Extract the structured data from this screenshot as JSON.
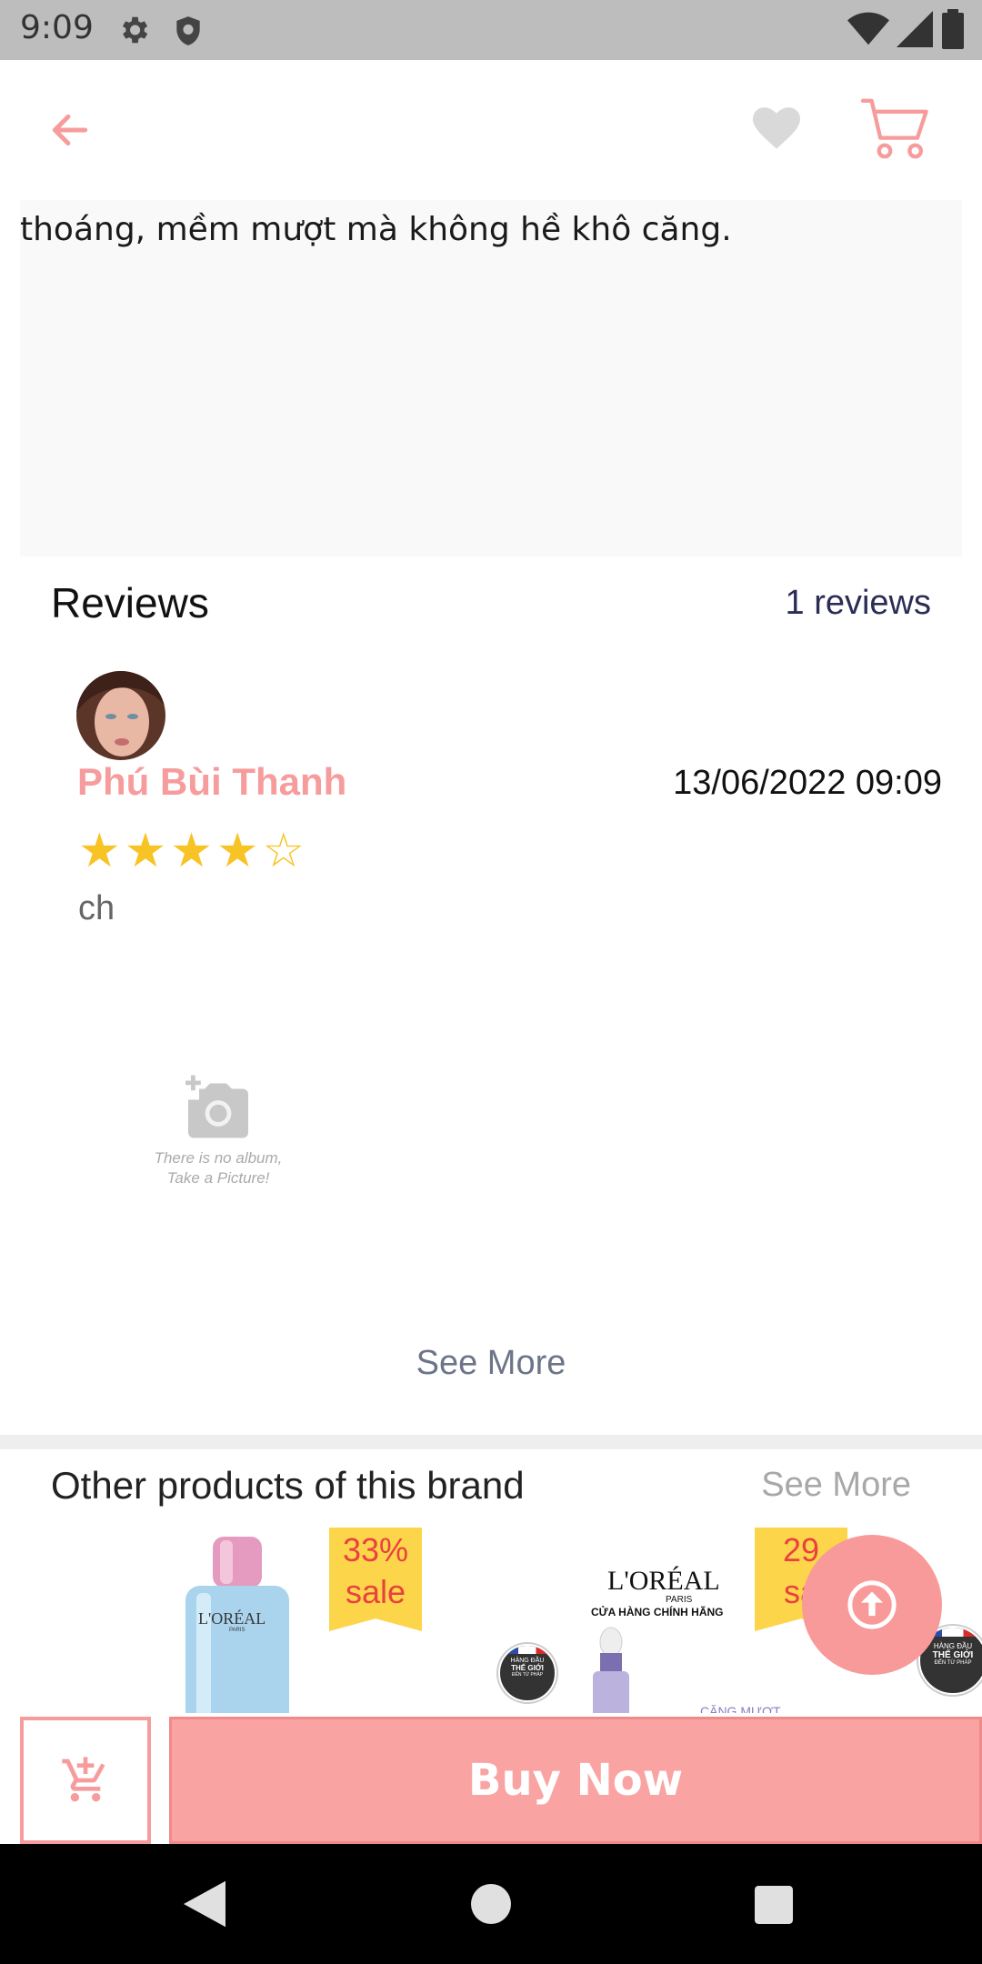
{
  "status_bar": {
    "time": "9:09"
  },
  "description": {
    "text": "thoáng, mềm mượt mà không hề khô căng."
  },
  "reviews": {
    "title": "Reviews",
    "count_label": "1 reviews",
    "items": [
      {
        "name": "Phú Bùi Thanh",
        "date": "13/06/2022 09:09",
        "rating": 4,
        "max_rating": 5,
        "text": "ch"
      }
    ],
    "no_album_line1": "There is no album,",
    "no_album_line2": "Take a Picture!",
    "see_more": "See More"
  },
  "other_products": {
    "title": "Other products of this brand",
    "see_more": "See More",
    "items": [
      {
        "brand": "L'ORÉAL",
        "brand_sub": "PARIS",
        "sale_pct": "33%",
        "sale_word": "sale"
      },
      {
        "brand": "L'ORÉAL",
        "brand_sub": "PARIS",
        "store_label": "CỬA HÀNG CHÍNH HÃNG",
        "sale_pct": "29",
        "sale_word": "sa",
        "tag": "CĂNG MƯỢT",
        "badge_line1": "HÀNG ĐẦU",
        "badge_line2": "THẾ GIỚI",
        "badge_line3": "ĐẾN TỪ PHÁP"
      }
    ]
  },
  "bottom_bar": {
    "buy_now": "Buy Now"
  },
  "colors": {
    "accent": "#f79c9c",
    "star": "#f7c325",
    "sale": "#fcd54a"
  },
  "icons": [
    "settings-icon",
    "shield-icon",
    "wifi-icon",
    "signal-icon",
    "battery-icon",
    "back-arrow-icon",
    "heart-icon",
    "cart-icon",
    "add-photo-icon",
    "arrow-up-icon",
    "add-to-cart-icon"
  ]
}
